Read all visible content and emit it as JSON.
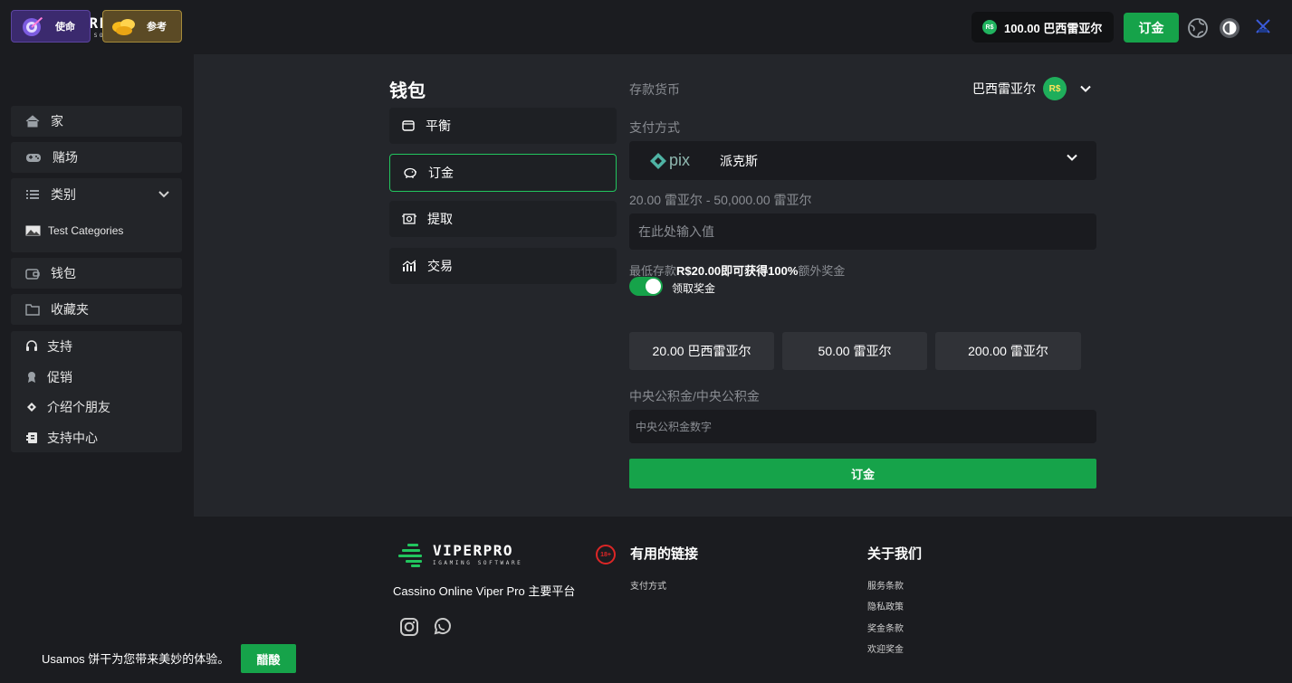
{
  "brand": {
    "name": "VIPERPRO",
    "tagline": "IGAMING SOFTWARE"
  },
  "header": {
    "balance_currency_badge": "R$",
    "balance": "100.00 巴西雷亚尔",
    "deposit_label": "订金"
  },
  "sidebar": {
    "promos": {
      "mission": "使命",
      "referral": "参考"
    },
    "items": [
      {
        "label": "家",
        "icon": "home-icon"
      },
      {
        "label": "赌场",
        "icon": "gamepad-icon"
      },
      {
        "label": "类别",
        "icon": "list-icon"
      },
      {
        "label": "Test Categories",
        "icon": "image-icon"
      },
      {
        "label": "钱包",
        "icon": "wallet-icon"
      },
      {
        "label": "收藏夹",
        "icon": "folder-icon"
      },
      {
        "label": "支持",
        "icon": "headset-icon"
      },
      {
        "label": "促销",
        "icon": "award-icon"
      },
      {
        "label": "介绍个朋友",
        "icon": "ticket-icon"
      },
      {
        "label": "支持中心",
        "icon": "help-icon"
      }
    ]
  },
  "wallet": {
    "title": "钱包",
    "tabs": [
      {
        "label": "平衡",
        "icon": "wallet-icon"
      },
      {
        "label": "订金",
        "icon": "piggy-bank-icon"
      },
      {
        "label": "提取",
        "icon": "withdraw-icon"
      },
      {
        "label": "交易",
        "icon": "chart-icon"
      }
    ],
    "active_tab": 1
  },
  "deposit_form": {
    "currency_label": "存款货币",
    "currency_value": "巴西雷亚尔",
    "currency_badge": "R$",
    "payment_label": "支付方式",
    "payment_logo_text": "pix",
    "payment_value": "派克斯",
    "range_label": "20.00 雷亚尔 - 50,000.00 雷亚尔",
    "amount_placeholder": "在此处输入值",
    "bonus_prefix": "最低存款",
    "bonus_highlight": "R$20.00即可获得100%",
    "bonus_suffix": "额外奖金",
    "bonus_toggle_label": "领取奖金",
    "bonus_toggle_on": true,
    "quick_amounts": [
      "20.00 巴西雷亚尔",
      "50.00 雷亚尔",
      "200.00 雷亚尔"
    ],
    "cpf_label": "中央公积金/中央公积金",
    "cpf_placeholder": "中央公积金数字",
    "submit_label": "订金"
  },
  "footer": {
    "tagline": "Cassino Online Viper Pro 主要平台",
    "age_badge": "18+",
    "useful_links_title": "有用的链接",
    "useful_links": [
      "支付方式"
    ],
    "about_title": "关于我们",
    "about_links": [
      "服务条款",
      "隐私政策",
      "奖金条款",
      "欢迎奖金"
    ]
  },
  "cookie": {
    "message": "Usamos 饼干为您带来美妙的体验。",
    "button": "醋酸"
  },
  "colors": {
    "accent": "#16a34a",
    "bg": "#24262b",
    "panel": "#1b1c20"
  }
}
